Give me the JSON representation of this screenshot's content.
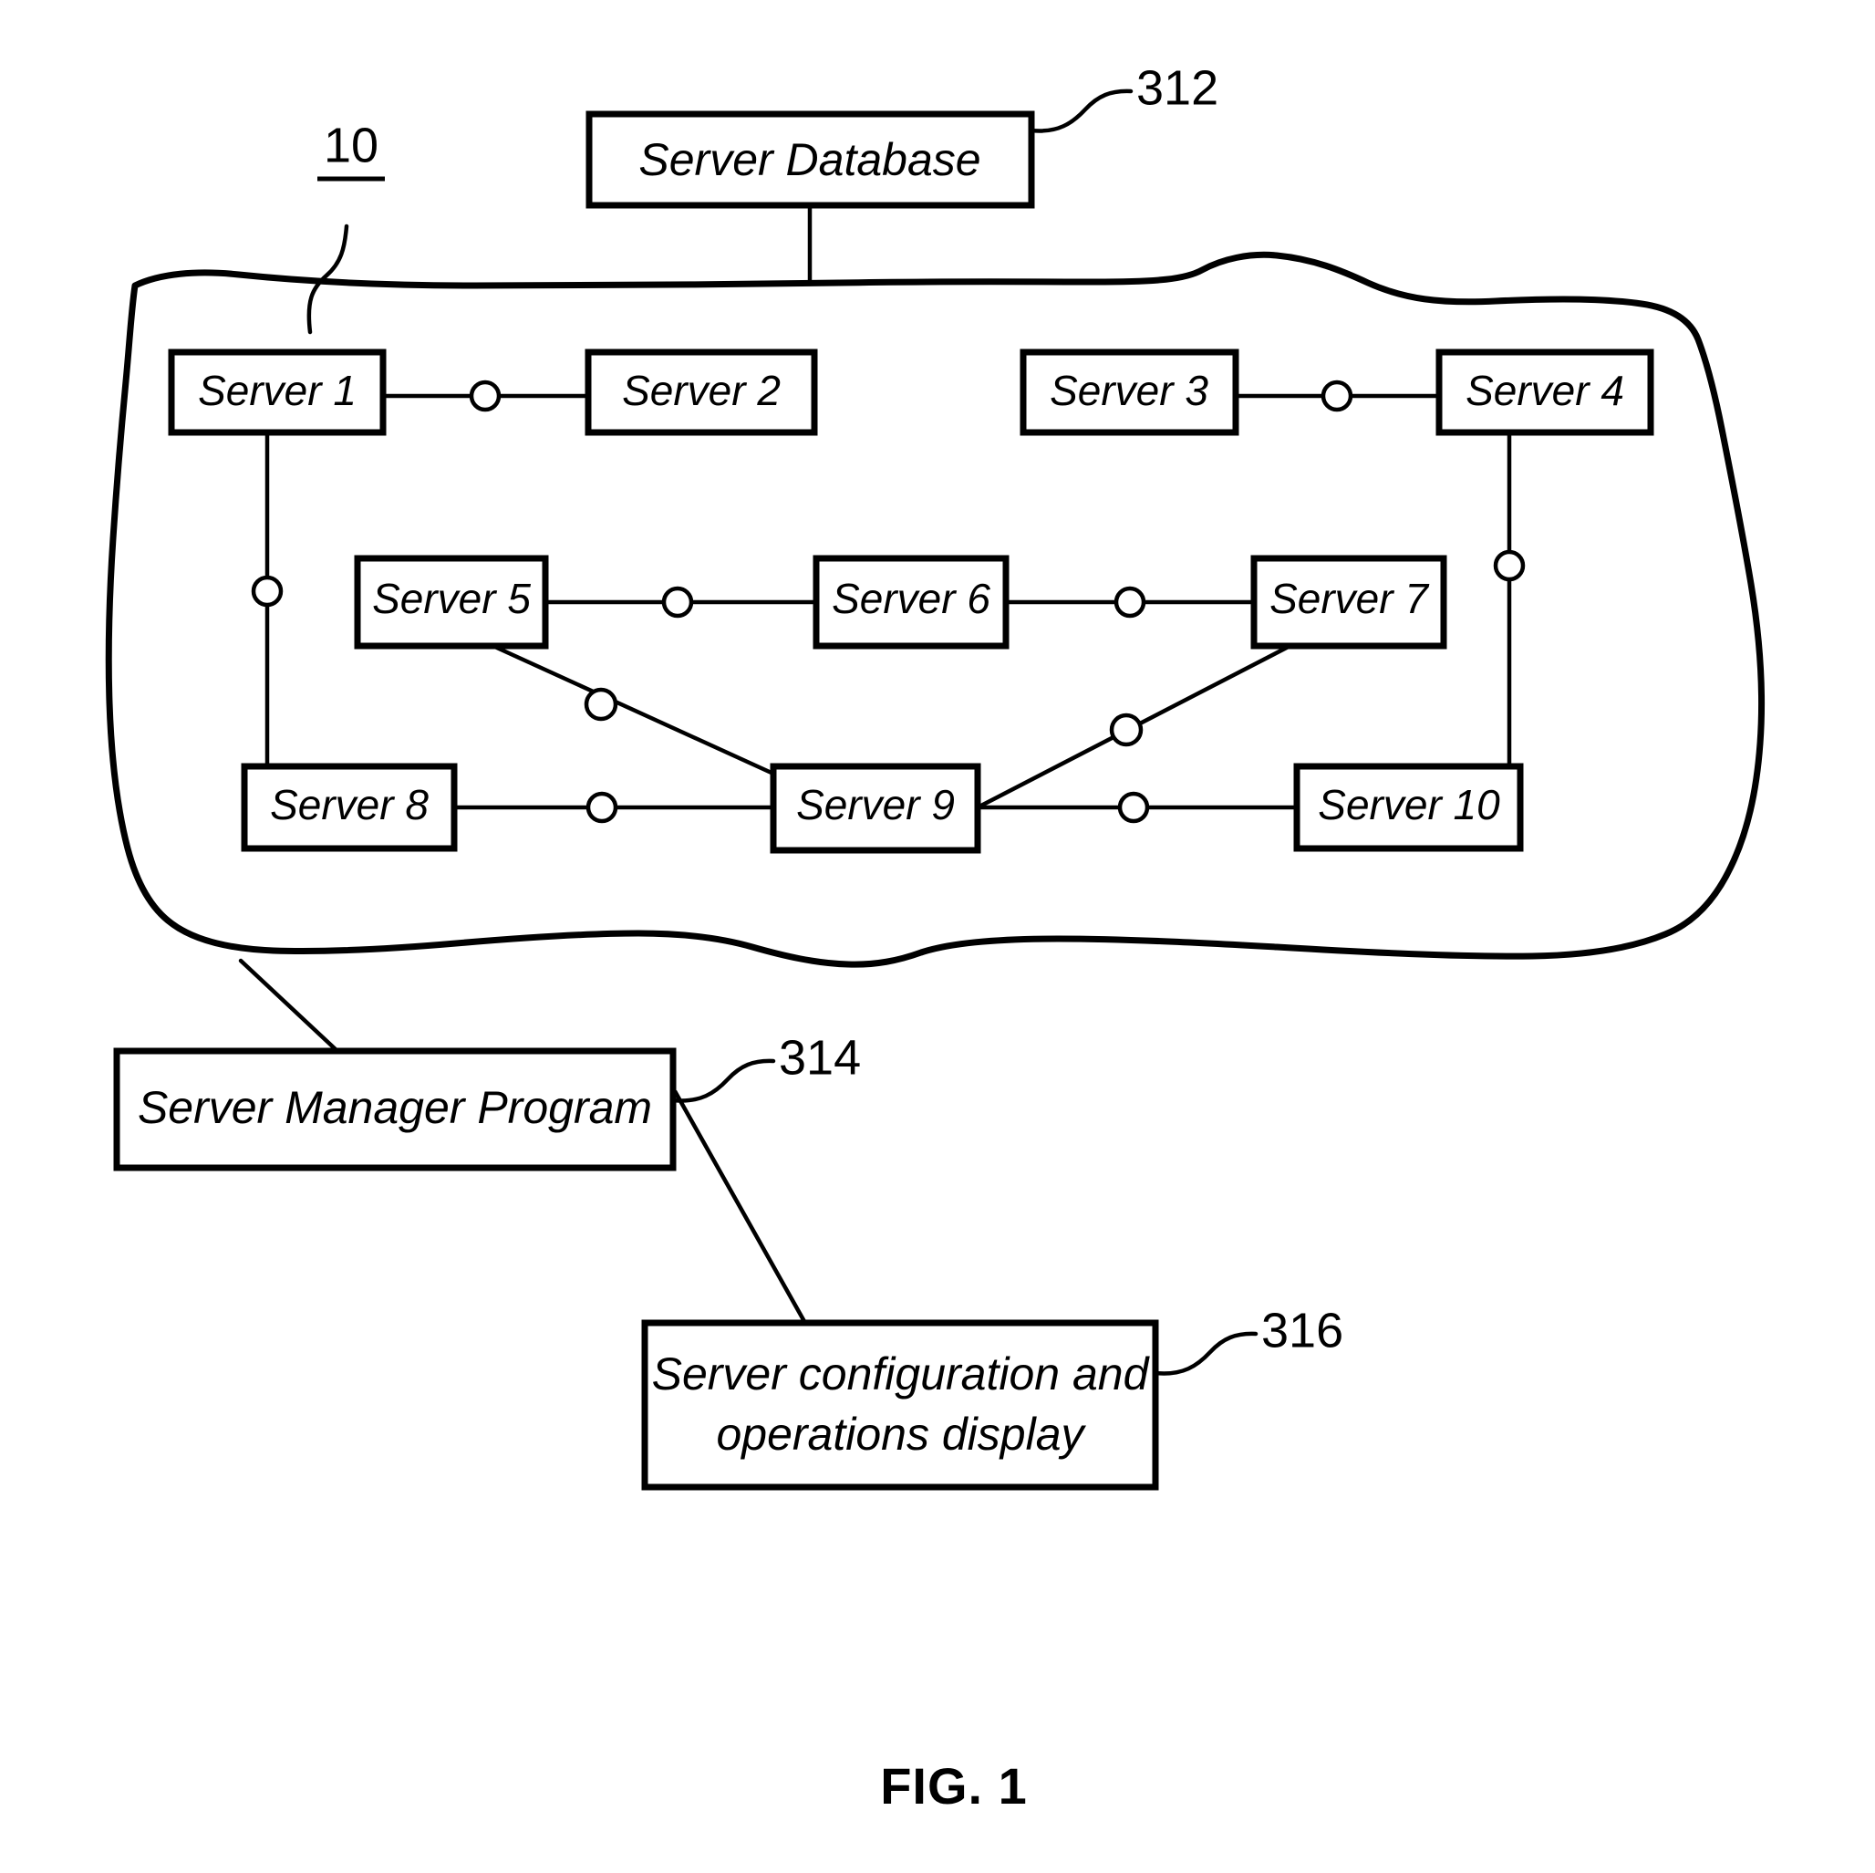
{
  "figure": {
    "caption": "FIG. 1",
    "system_ref": "10"
  },
  "boxes": {
    "server_database": {
      "label": "Server Database",
      "ref": "312"
    },
    "server_manager_program": {
      "label": "Server Manager Program",
      "ref": "314"
    },
    "display": {
      "label_line1": "Server configuration and",
      "label_line2": "operations display",
      "ref": "316"
    }
  },
  "servers": [
    {
      "id": "server1",
      "label": "Server 1"
    },
    {
      "id": "server2",
      "label": "Server 2"
    },
    {
      "id": "server3",
      "label": "Server 3"
    },
    {
      "id": "server4",
      "label": "Server 4"
    },
    {
      "id": "server5",
      "label": "Server 5"
    },
    {
      "id": "server6",
      "label": "Server 6"
    },
    {
      "id": "server7",
      "label": "Server 7"
    },
    {
      "id": "server8",
      "label": "Server 8"
    },
    {
      "id": "server9",
      "label": "Server 9"
    },
    {
      "id": "server10",
      "label": "Server 10"
    }
  ],
  "connections": [
    {
      "from": "server1",
      "to": "server2",
      "node": true
    },
    {
      "from": "server3",
      "to": "server4",
      "node": true
    },
    {
      "from": "server5",
      "to": "server6",
      "node": true
    },
    {
      "from": "server6",
      "to": "server7",
      "node": true
    },
    {
      "from": "server8",
      "to": "server9",
      "node": true
    },
    {
      "from": "server9",
      "to": "server10",
      "node": true
    },
    {
      "from": "server1",
      "to": "server8",
      "node": true
    },
    {
      "from": "server4",
      "to": "server10",
      "node": true
    },
    {
      "from": "server5",
      "to": "server9",
      "node": true
    },
    {
      "from": "server7",
      "to": "server9",
      "node": true
    }
  ],
  "colors": {
    "ink": "#000000",
    "paper": "#ffffff"
  }
}
